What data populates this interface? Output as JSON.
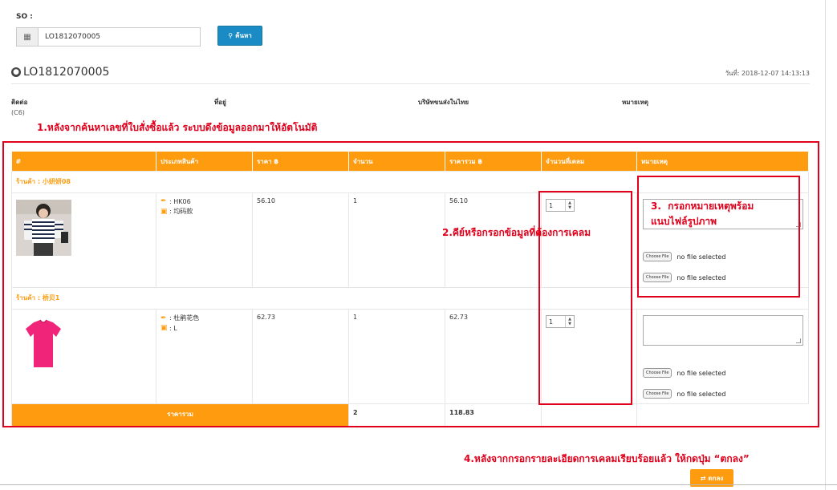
{
  "search": {
    "label": "SO :",
    "calendar_icon": "calendar-icon",
    "value": "LO1812070005",
    "button_label": "ค้นหา",
    "button_icon": "search-icon"
  },
  "header": {
    "globe_icon": "globe-icon",
    "title": "LO1812070005",
    "date_label": "วันที่: 2018-12-07 14:13:13"
  },
  "info": {
    "contact": "ติดต่อ",
    "address": "ที่อยู่",
    "shipping_company": "บริษัทขนส่งในไทย",
    "remark": "หมายเหตุ",
    "code": "(C6)"
  },
  "annotations": {
    "step1": "1.หลังจากค้นหาเลขที่ใบสั่งซื้อแล้ว ระบบดึงข้อมูลออกมาให้อัตโนมัติ",
    "step2": "2.คีย์หรือกรอกข้อมูลที่ต้องการเคลม",
    "step3_num": "3.",
    "step3_line1": "กรอกหมายเหตุพร้อม",
    "step3_line2": "แนบไฟล์รูปภาพ",
    "step4": "4.หลังจากกรอกรายละเอียดการเคลมเรียบร้อยแล้ว ให้กดปุ่ม “ตกลง”"
  },
  "table": {
    "columns": [
      "#",
      "ประเภทสินค้า",
      "ราคา ฿",
      "จำนวน",
      "ราคารวม ฿",
      "จำนวนที่เคลม",
      "หมายเหตุ"
    ],
    "groups": [
      {
        "shop": "ร้านค้า : 小妍妍08",
        "item": {
          "image_desc": "striped-shirt",
          "attr1": ": HK06",
          "attr2": ": 均码款",
          "price": "56.10",
          "qty": "1",
          "total": "56.10",
          "claim_qty": "1",
          "file1_button": "Choose File",
          "file1_status": "no file selected",
          "file2_button": "Choose File",
          "file2_status": "no file selected"
        }
      },
      {
        "shop": "ร้านค้า : 桥贝1",
        "item": {
          "image_desc": "pink-tshirt",
          "attr1": ": 杜鹃花色",
          "attr2": ": L",
          "price": "62.73",
          "qty": "1",
          "total": "62.73",
          "claim_qty": "1",
          "file1_button": "Choose File",
          "file1_status": "no file selected",
          "file2_button": "Choose File",
          "file2_status": "no file selected"
        }
      }
    ],
    "footer": {
      "label": "ราคารวม",
      "qty": "2",
      "total": "118.83"
    }
  },
  "submit": {
    "icon": "exchange-icon",
    "label": "ตกลง"
  },
  "colors": {
    "accent_orange": "#ff9b0f",
    "search_blue": "#1b8bc6",
    "annotation_red": "#e0001b"
  }
}
